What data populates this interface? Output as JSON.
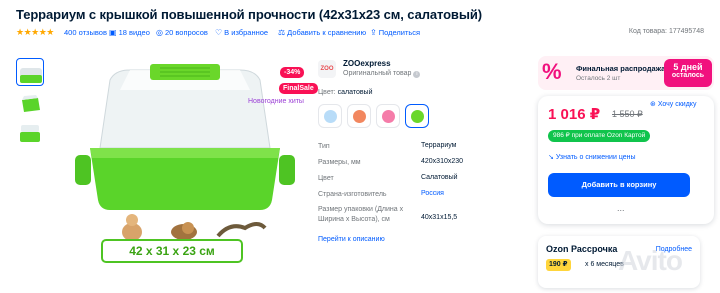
{
  "product": {
    "title": "Террариум с крышкой повышенной прочности (42x31x23 см, салатовый)",
    "rating_stars": "★★★★★",
    "reviews": "400 отзывов",
    "videos": "18 видео",
    "questions": "20 вопросов",
    "favorites": "В избранное",
    "compare": "Добавить к сравнению",
    "share": "Поделиться",
    "code": "Код товара: 177495748"
  },
  "gallery": {
    "discount_badge": "-34%",
    "finalsale_badge": "FinalSale",
    "new_hits": "Новогодние хиты",
    "size_label": "42 x 31 x 23 см"
  },
  "seller": {
    "logo_text": "ZOO",
    "name": "ZOOexpress",
    "subtitle": "Оригинальный товар"
  },
  "color": {
    "label": "Цвет:",
    "value": "салатовый",
    "swatches": [
      "#b8dcf8",
      "#f2875f",
      "#f57ca9",
      "#6ad72a"
    ]
  },
  "specs": [
    {
      "key": "Тип",
      "value": "Террариум"
    },
    {
      "key": "Размеры, мм",
      "value": "420х310х230"
    },
    {
      "key": "Цвет",
      "value": "Салатовый"
    },
    {
      "key": "Страна-изготовитель",
      "value": "Россия"
    },
    {
      "key": "Размер упаковки (Длина х Ширина х Высота), см",
      "value": "40x31x15,5"
    }
  ],
  "go_to_description": "Перейти к описанию",
  "sale": {
    "icon": "%",
    "title": "Финальная распродажа",
    "left": "Осталось 2 шт",
    "days": "5 дней",
    "days_sub": "осталось"
  },
  "price": {
    "current": "1 016 ₽",
    "old": "1 550 ₽",
    "want_cheaper": "Хочу скидку",
    "ozon_card": "986 ₽ при оплате Ozon Картой",
    "notify": "Узнать о снижении цены",
    "add_to_cart": "Добавить в корзину",
    "more": "..."
  },
  "installment": {
    "title": "Ozon Рассрочка",
    "more": "Подробнее",
    "payment": "190 ₽",
    "period": "х 6 месяцев"
  },
  "watermark": "Avito",
  "colors": {
    "brand_blue": "#005bff",
    "sale_pink": "#f1117e",
    "price_red": "#f91155",
    "ozon_green": "#10c44c",
    "star_orange": "#ffa800"
  }
}
